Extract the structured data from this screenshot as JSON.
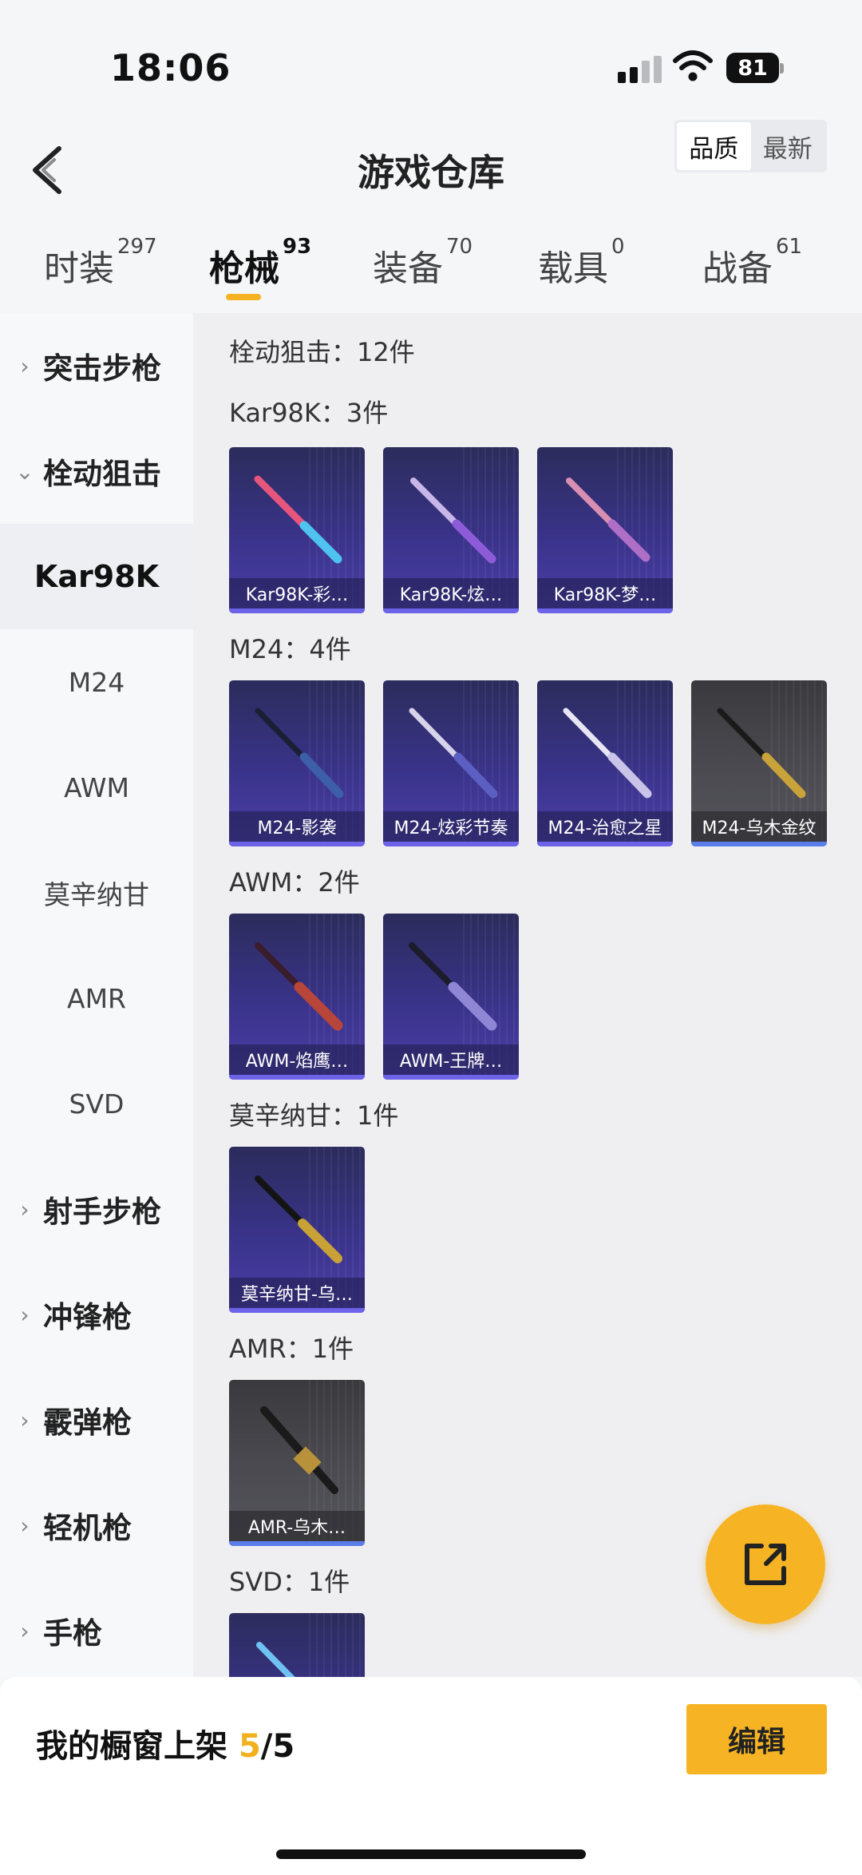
{
  "status_bar": {
    "time": "18:06",
    "battery": "81"
  },
  "header": {
    "title": "游戏仓库",
    "sort_options": [
      "品质",
      "最新"
    ]
  },
  "top_tabs": [
    {
      "label": "时装",
      "count": "297"
    },
    {
      "label": "枪械",
      "count": "93"
    },
    {
      "label": "装备",
      "count": "70"
    },
    {
      "label": "载具",
      "count": "0"
    },
    {
      "label": "战备",
      "count": "61"
    }
  ],
  "sidebar": {
    "items": [
      {
        "label": "突击步枪",
        "chevron": "›"
      },
      {
        "label": "栓动狙击",
        "chevron": "⌄"
      },
      {
        "label": "Kar98K"
      },
      {
        "label": "M24"
      },
      {
        "label": "AWM"
      },
      {
        "label": "莫辛纳甘"
      },
      {
        "label": "AMR"
      },
      {
        "label": "SVD"
      },
      {
        "label": "射手步枪",
        "chevron": "›"
      },
      {
        "label": "冲锋枪",
        "chevron": "›"
      },
      {
        "label": "霰弹枪",
        "chevron": "›"
      },
      {
        "label": "轻机枪",
        "chevron": "›"
      },
      {
        "label": "手枪",
        "chevron": "›"
      }
    ]
  },
  "content": {
    "category_total": "栓动狙击：12件",
    "sections": [
      {
        "label": "Kar98K：3件",
        "items": [
          "Kar98K-彩…",
          "Kar98K-炫…",
          "Kar98K-梦…"
        ]
      },
      {
        "label": "M24：4件",
        "items": [
          "M24-影袭",
          "M24-炫彩节奏",
          "M24-治愈之星",
          "M24-乌木金纹"
        ]
      },
      {
        "label": "AWM：2件",
        "items": [
          "AWM-焰鹰…",
          "AWM-王牌…"
        ]
      },
      {
        "label": "莫辛纳甘：1件",
        "items": [
          "莫辛纳甘-乌…"
        ]
      },
      {
        "label": "AMR：1件",
        "items": [
          "AMR-乌木…"
        ]
      },
      {
        "label": "SVD：1件",
        "items": []
      }
    ]
  },
  "bottom_bar": {
    "showcase_prefix": "我的橱窗上架",
    "showcase_used": "5",
    "showcase_total": "/5",
    "edit_label": "编辑"
  },
  "colors": {
    "accent": "#f6b424",
    "card_purple": "#3a338a",
    "card_gray": "#4c4c52"
  }
}
